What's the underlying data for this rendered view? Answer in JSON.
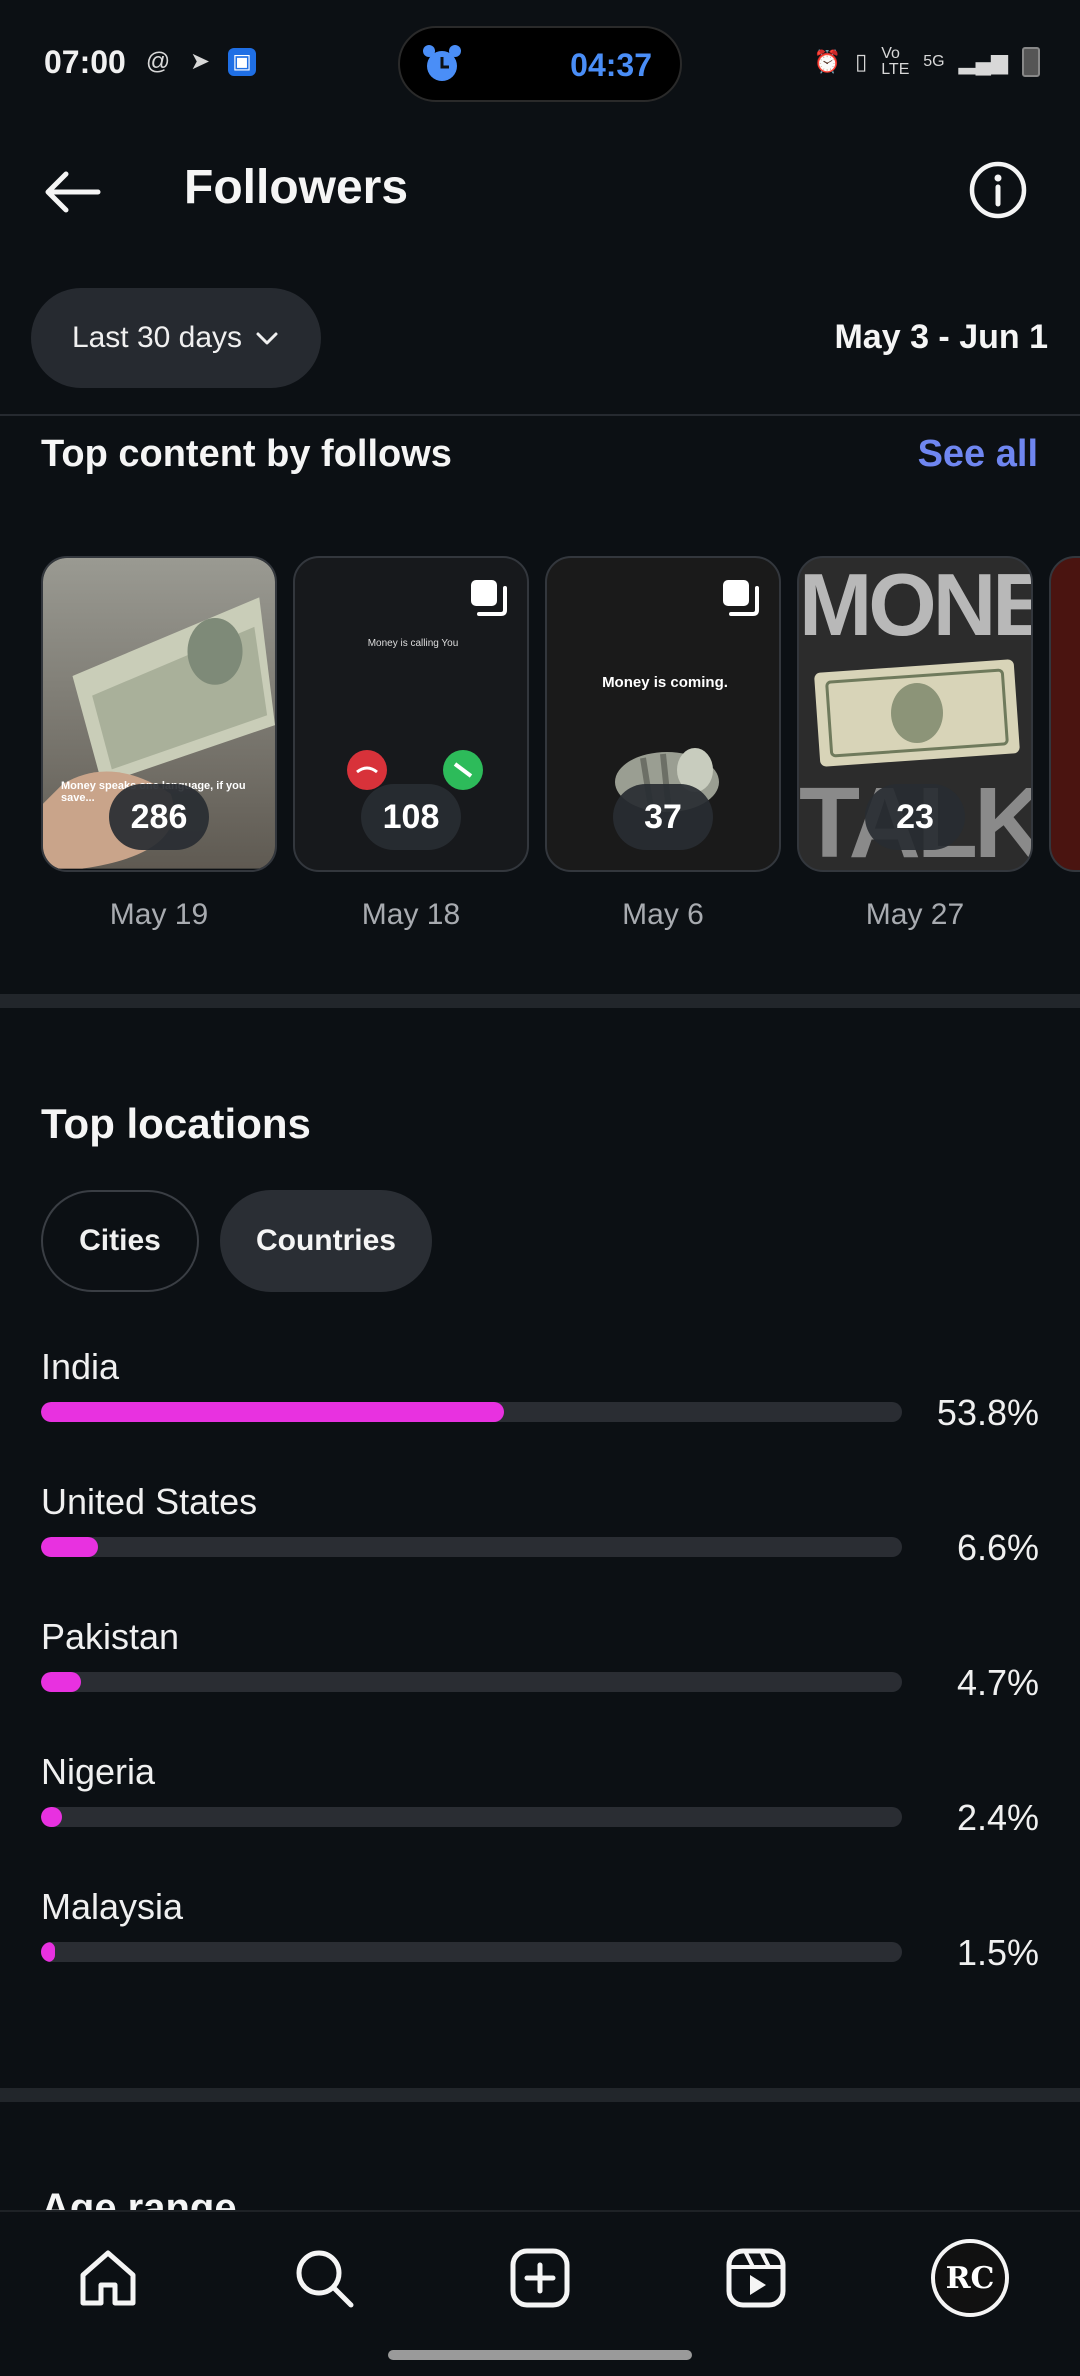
{
  "status_bar": {
    "time": "07:00",
    "alarm_time": "04:37",
    "network": "5G",
    "volte": "Vo LTE"
  },
  "header": {
    "title": "Followers"
  },
  "filter": {
    "range_label": "Last 30 days",
    "date_range": "May 3 - Jun 1"
  },
  "top_content": {
    "title": "Top content by follows",
    "see_all": "See all",
    "items": [
      {
        "count": "286",
        "date": "May 19",
        "caption": "Money speaks one language, if you save..."
      },
      {
        "count": "108",
        "date": "May 18",
        "caption": "Money is calling You"
      },
      {
        "count": "37",
        "date": "May 6",
        "caption": "Money is coming."
      },
      {
        "count": "23",
        "date": "May 27",
        "caption_top": "MONEY",
        "caption_bottom": "TALK"
      }
    ]
  },
  "locations": {
    "title": "Top locations",
    "chips": {
      "cities": "Cities",
      "countries": "Countries"
    },
    "items": [
      {
        "name": "India",
        "pct": "53.8%",
        "share": 0.538
      },
      {
        "name": "United States",
        "pct": "6.6%",
        "share": 0.066
      },
      {
        "name": "Pakistan",
        "pct": "4.7%",
        "share": 0.047
      },
      {
        "name": "Nigeria",
        "pct": "2.4%",
        "share": 0.024
      },
      {
        "name": "Malaysia",
        "pct": "1.5%",
        "share": 0.015
      }
    ]
  },
  "age_range": {
    "title": "Age range"
  },
  "bottom_nav": {
    "avatar_initials": "RC"
  },
  "colors": {
    "background": "#0c1014",
    "accent_link": "#6f86f0",
    "bar_fill": "#e831e0"
  }
}
